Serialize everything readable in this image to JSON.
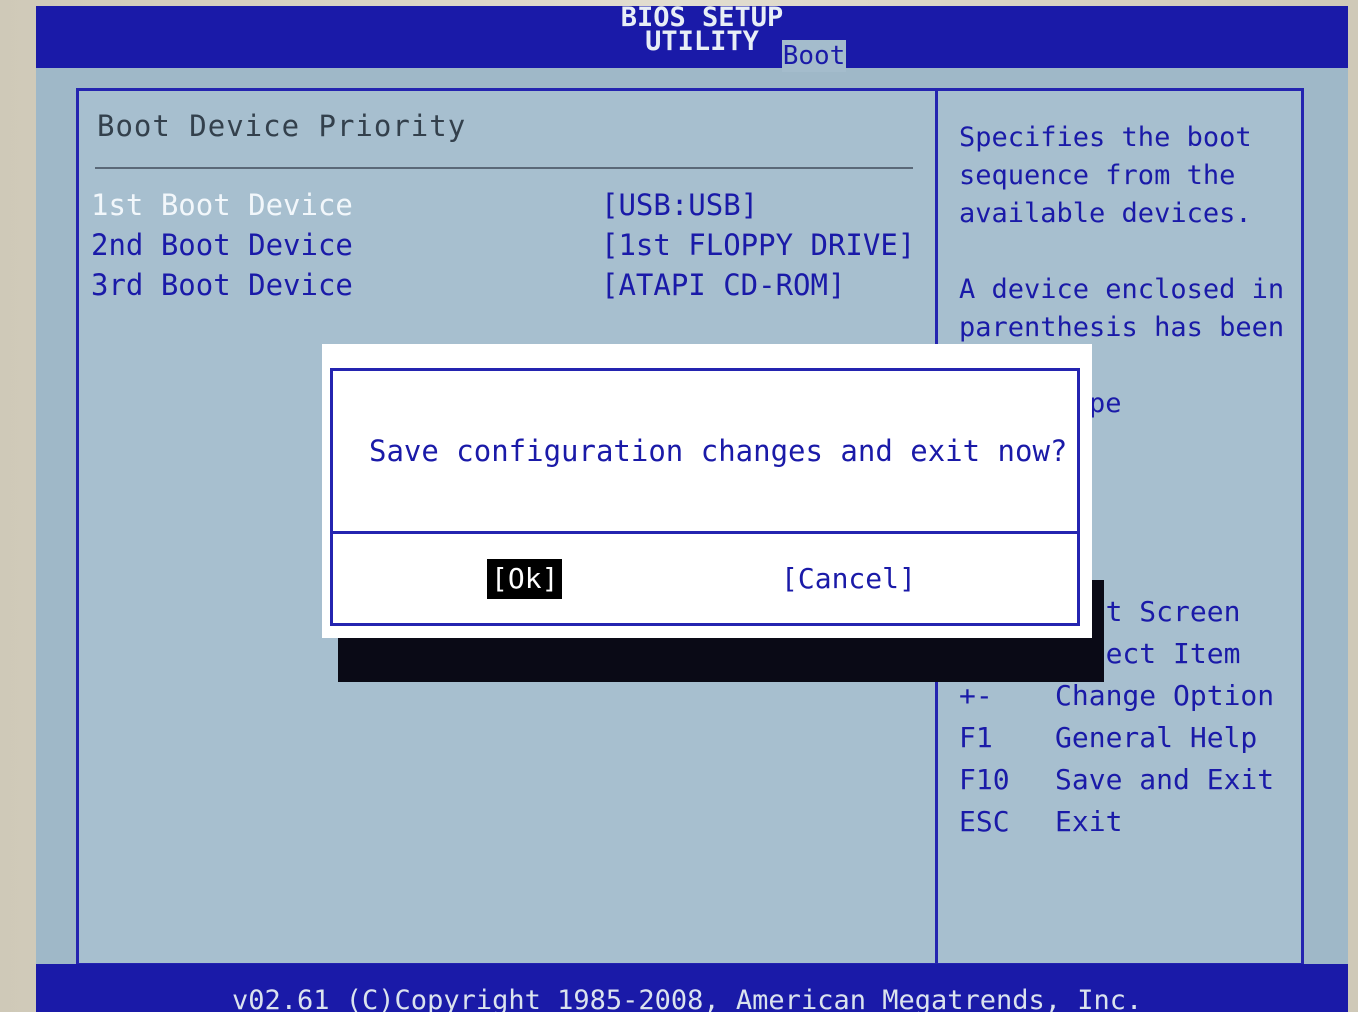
{
  "window": {
    "title": "BIOS SETUP UTILITY",
    "active_tab": "Boot"
  },
  "section": {
    "title": "Boot Device Priority"
  },
  "boot_devices": [
    {
      "label": "1st Boot Device",
      "value": "[USB:USB]"
    },
    {
      "label": "2nd Boot Device",
      "value": "[1st FLOPPY DRIVE]"
    },
    {
      "label": "3rd Boot Device",
      "value": "[ATAPI CD-ROM]"
    }
  ],
  "help": {
    "text1": "Specifies the boot\nsequence from the\navailable devices.",
    "text2": "A device enclosed in\nparenthesis has been\nd in the\nnding type"
  },
  "keys": [
    {
      "key": "",
      "desc": "lect Screen"
    },
    {
      "key": "↑↓",
      "desc": "Select Item"
    },
    {
      "key": "+-",
      "desc": "Change Option"
    },
    {
      "key": "F1",
      "desc": "General Help"
    },
    {
      "key": "F10",
      "desc": "Save and Exit"
    },
    {
      "key": "ESC",
      "desc": "Exit"
    }
  ],
  "dialog": {
    "question": "Save configuration changes and exit now?",
    "ok_label": "[Ok]",
    "cancel_label": "[Cancel]"
  },
  "footer": {
    "text": "v02.61 (C)Copyright 1985-2008, American Megatrends, Inc."
  },
  "colors": {
    "bios_blue": "#1a1aa8",
    "background": "#a7bfcf",
    "dialog_bg": "#ffffff"
  }
}
